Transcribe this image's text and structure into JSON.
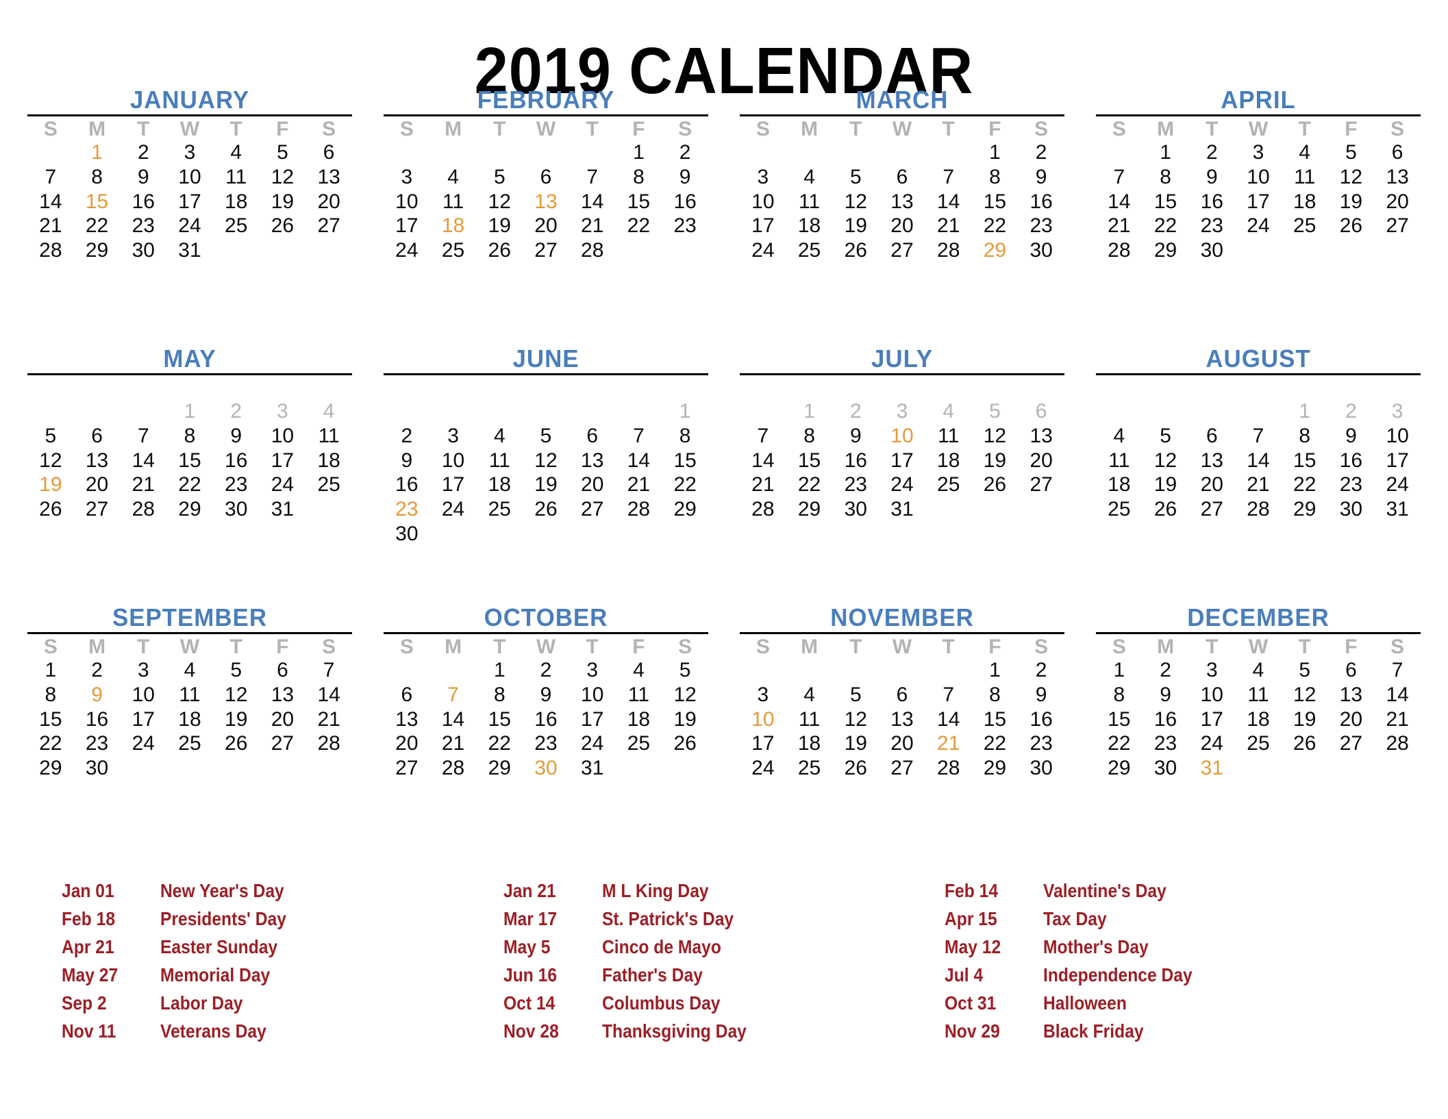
{
  "title": "2019 CALENDAR",
  "colors": {
    "month_name": "#4a7ebb",
    "weekday_header": "#b3b3b3",
    "day": "#0d0d0d",
    "highlight_day": "#e69a39",
    "dim_day": "#b3b3b3",
    "holiday_text": "#9c1f26",
    "rule": "#000000",
    "background": "#ffffff"
  },
  "weekday_headers": [
    "S",
    "M",
    "T",
    "W",
    "T",
    "F",
    "S"
  ],
  "months": [
    {
      "name": "JANUARY",
      "show_headers": true,
      "weeks": [
        [
          "",
          "1",
          "2",
          "3",
          "4",
          "5",
          "6"
        ],
        [
          "7",
          "8",
          "9",
          "10",
          "11",
          "12",
          "13"
        ],
        [
          "14",
          "15",
          "16",
          "17",
          "18",
          "19",
          "20"
        ],
        [
          "21",
          "22",
          "23",
          "24",
          "25",
          "26",
          "27"
        ],
        [
          "28",
          "29",
          "30",
          "31",
          "",
          "",
          ""
        ]
      ],
      "highlighted": [
        "1",
        "15"
      ],
      "dimmed": []
    },
    {
      "name": "FEBRUARY",
      "show_headers": true,
      "weeks": [
        [
          "",
          "",
          "",
          "",
          "",
          "1",
          "2"
        ],
        [
          "3",
          "4",
          "5",
          "6",
          "7",
          "8",
          "9"
        ],
        [
          "10",
          "11",
          "12",
          "13",
          "14",
          "15",
          "16"
        ],
        [
          "17",
          "18",
          "19",
          "20",
          "21",
          "22",
          "23"
        ],
        [
          "24",
          "25",
          "26",
          "27",
          "28",
          "",
          ""
        ]
      ],
      "highlighted": [
        "13",
        "18"
      ],
      "dimmed": []
    },
    {
      "name": "MARCH",
      "show_headers": true,
      "weeks": [
        [
          "",
          "",
          "",
          "",
          "",
          "1",
          "2"
        ],
        [
          "3",
          "4",
          "5",
          "6",
          "7",
          "8",
          "9"
        ],
        [
          "10",
          "11",
          "12",
          "13",
          "14",
          "15",
          "16"
        ],
        [
          "17",
          "18",
          "19",
          "20",
          "21",
          "22",
          "23"
        ],
        [
          "24",
          "25",
          "26",
          "27",
          "28",
          "29",
          "30"
        ]
      ],
      "highlighted": [
        "29"
      ],
      "dimmed": []
    },
    {
      "name": "APRIL",
      "show_headers": true,
      "weeks": [
        [
          "",
          "1",
          "2",
          "3",
          "4",
          "5",
          "6"
        ],
        [
          "7",
          "8",
          "9",
          "10",
          "11",
          "12",
          "13"
        ],
        [
          "14",
          "15",
          "16",
          "17",
          "18",
          "19",
          "20"
        ],
        [
          "21",
          "22",
          "23",
          "24",
          "25",
          "26",
          "27"
        ],
        [
          "28",
          "29",
          "30",
          "",
          "",
          "",
          ""
        ]
      ],
      "highlighted": [],
      "dimmed": []
    },
    {
      "name": "MAY",
      "show_headers": false,
      "weeks": [
        [
          "",
          "",
          "",
          "1",
          "2",
          "3",
          "4"
        ],
        [
          "5",
          "6",
          "7",
          "8",
          "9",
          "10",
          "11"
        ],
        [
          "12",
          "13",
          "14",
          "15",
          "16",
          "17",
          "18"
        ],
        [
          "19",
          "20",
          "21",
          "22",
          "23",
          "24",
          "25"
        ],
        [
          "26",
          "27",
          "28",
          "29",
          "30",
          "31",
          ""
        ]
      ],
      "highlighted": [
        "19"
      ],
      "dimmed": [
        "1",
        "2",
        "3",
        "4"
      ]
    },
    {
      "name": "JUNE",
      "show_headers": false,
      "weeks": [
        [
          "",
          "",
          "",
          "",
          "",
          "",
          "1"
        ],
        [
          "2",
          "3",
          "4",
          "5",
          "6",
          "7",
          "8"
        ],
        [
          "9",
          "10",
          "11",
          "12",
          "13",
          "14",
          "15"
        ],
        [
          "16",
          "17",
          "18",
          "19",
          "20",
          "21",
          "22"
        ],
        [
          "23",
          "24",
          "25",
          "26",
          "27",
          "28",
          "29"
        ],
        [
          "30",
          "",
          "",
          "",
          "",
          "",
          ""
        ]
      ],
      "highlighted": [
        "23"
      ],
      "dimmed": [
        "1"
      ]
    },
    {
      "name": "JULY",
      "show_headers": false,
      "weeks": [
        [
          "",
          "1",
          "2",
          "3",
          "4",
          "5",
          "6"
        ],
        [
          "7",
          "8",
          "9",
          "10",
          "11",
          "12",
          "13"
        ],
        [
          "14",
          "15",
          "16",
          "17",
          "18",
          "19",
          "20"
        ],
        [
          "21",
          "22",
          "23",
          "24",
          "25",
          "26",
          "27"
        ],
        [
          "28",
          "29",
          "30",
          "31",
          "",
          "",
          ""
        ]
      ],
      "highlighted": [
        "10"
      ],
      "dimmed": [
        "1",
        "2",
        "3",
        "4",
        "5",
        "6"
      ]
    },
    {
      "name": "AUGUST",
      "show_headers": false,
      "weeks": [
        [
          "",
          "",
          "",
          "",
          "1",
          "2",
          "3"
        ],
        [
          "4",
          "5",
          "6",
          "7",
          "8",
          "9",
          "10"
        ],
        [
          "11",
          "12",
          "13",
          "14",
          "15",
          "16",
          "17"
        ],
        [
          "18",
          "19",
          "20",
          "21",
          "22",
          "23",
          "24"
        ],
        [
          "25",
          "26",
          "27",
          "28",
          "29",
          "30",
          "31"
        ]
      ],
      "highlighted": [],
      "dimmed": [
        "1",
        "2",
        "3"
      ]
    },
    {
      "name": "SEPTEMBER",
      "show_headers": true,
      "weeks": [
        [
          "1",
          "2",
          "3",
          "4",
          "5",
          "6",
          "7"
        ],
        [
          "8",
          "9",
          "10",
          "11",
          "12",
          "13",
          "14"
        ],
        [
          "15",
          "16",
          "17",
          "18",
          "19",
          "20",
          "21"
        ],
        [
          "22",
          "23",
          "24",
          "25",
          "26",
          "27",
          "28"
        ],
        [
          "29",
          "30",
          "",
          "",
          "",
          "",
          ""
        ]
      ],
      "highlighted": [
        "9"
      ],
      "dimmed": []
    },
    {
      "name": "OCTOBER",
      "show_headers": true,
      "weeks": [
        [
          "",
          "",
          "1",
          "2",
          "3",
          "4",
          "5"
        ],
        [
          "6",
          "7",
          "8",
          "9",
          "10",
          "11",
          "12"
        ],
        [
          "13",
          "14",
          "15",
          "16",
          "17",
          "18",
          "19"
        ],
        [
          "20",
          "21",
          "22",
          "23",
          "24",
          "25",
          "26"
        ],
        [
          "27",
          "28",
          "29",
          "30",
          "31",
          "",
          ""
        ]
      ],
      "highlighted": [
        "7",
        "30"
      ],
      "dimmed": []
    },
    {
      "name": "NOVEMBER",
      "show_headers": true,
      "weeks": [
        [
          "",
          "",
          "",
          "",
          "",
          "1",
          "2"
        ],
        [
          "3",
          "4",
          "5",
          "6",
          "7",
          "8",
          "9"
        ],
        [
          "10",
          "11",
          "12",
          "13",
          "14",
          "15",
          "16"
        ],
        [
          "17",
          "18",
          "19",
          "20",
          "21",
          "22",
          "23"
        ],
        [
          "24",
          "25",
          "26",
          "27",
          "28",
          "29",
          "30"
        ]
      ],
      "highlighted": [
        "10",
        "21"
      ],
      "dimmed": []
    },
    {
      "name": "DECEMBER",
      "show_headers": true,
      "weeks": [
        [
          "1",
          "2",
          "3",
          "4",
          "5",
          "6",
          "7"
        ],
        [
          "8",
          "9",
          "10",
          "11",
          "12",
          "13",
          "14"
        ],
        [
          "15",
          "16",
          "17",
          "18",
          "19",
          "20",
          "21"
        ],
        [
          "22",
          "23",
          "24",
          "25",
          "26",
          "27",
          "28"
        ],
        [
          "29",
          "30",
          "31",
          "",
          "",
          "",
          ""
        ]
      ],
      "highlighted": [
        "31"
      ],
      "dimmed": []
    }
  ],
  "holiday_columns": [
    [
      {
        "date": "Jan 01",
        "name": "New Year's Day"
      },
      {
        "date": "Feb 18",
        "name": "Presidents' Day"
      },
      {
        "date": "Apr 21",
        "name": "Easter Sunday"
      },
      {
        "date": "May 27",
        "name": "Memorial Day"
      },
      {
        "date": "Sep 2",
        "name": "Labor Day"
      },
      {
        "date": "Nov 11",
        "name": "Veterans Day"
      }
    ],
    [
      {
        "date": "Jan 21",
        "name": "M L King Day"
      },
      {
        "date": "Mar 17",
        "name": "St. Patrick's Day"
      },
      {
        "date": "May 5",
        "name": "Cinco de Mayo"
      },
      {
        "date": "Jun 16",
        "name": "Father's Day"
      },
      {
        "date": "Oct 14",
        "name": "Columbus Day"
      },
      {
        "date": "Nov 28",
        "name": "Thanksgiving Day"
      }
    ],
    [
      {
        "date": "Feb 14",
        "name": "Valentine's Day"
      },
      {
        "date": "Apr 15",
        "name": "Tax Day"
      },
      {
        "date": "May 12",
        "name": "Mother's Day"
      },
      {
        "date": "Jul 4",
        "name": "Independence Day"
      },
      {
        "date": "Oct 31",
        "name": "Halloween"
      },
      {
        "date": "Nov 29",
        "name": "Black Friday"
      }
    ]
  ]
}
